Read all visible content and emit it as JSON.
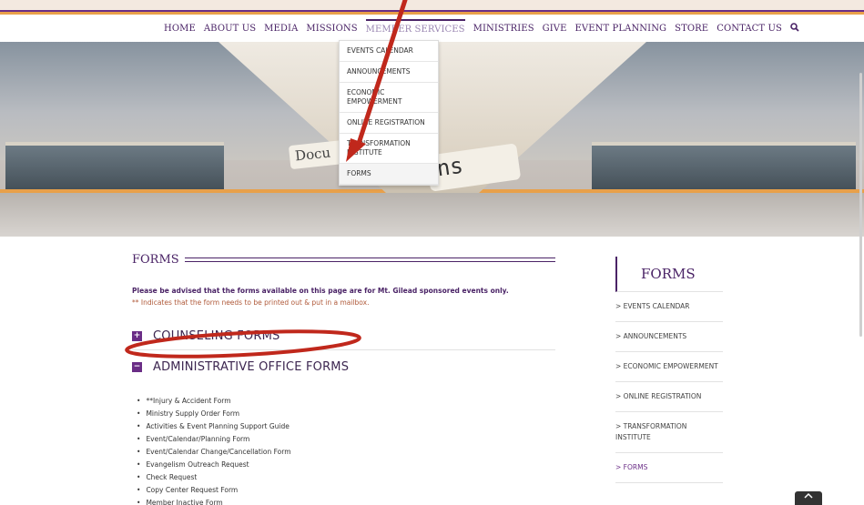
{
  "nav": {
    "items": [
      "HOME",
      "ABOUT US",
      "MEDIA",
      "MISSIONS",
      "MEMBER SERVICES",
      "MINISTRIES",
      "GIVE",
      "EVENT PLANNING",
      "STORE",
      "CONTACT US"
    ],
    "search_icon": "search-icon"
  },
  "dropdown": {
    "items": [
      "EVENTS CALENDAR",
      "ANNOUNCEMENTS",
      "ECONOMIC EMPOWERMENT",
      "ONLINE REGISTRATION",
      "TRANSFORMATION INSTITUTE",
      "FORMS"
    ]
  },
  "hero": {
    "folder_text_left": "Docu",
    "folder_text_right": "ns"
  },
  "content": {
    "title": "FORMS",
    "notice_bold": "Please be advised that the forms available on this page are for Mt. Gilead sponsored events only.",
    "notice": "** Indicates that the form needs to be printed out & put in a mailbox.",
    "sections": [
      {
        "toggle": "+",
        "label": "COUNSELING FORMS"
      },
      {
        "toggle": "−",
        "label": "ADMINISTRATIVE OFFICE FORMS"
      }
    ],
    "forms": [
      "**Injury & Accident Form",
      "Ministry Supply Order Form",
      "Activities & Event Planning Support Guide",
      "Event/Calendar/Planning Form",
      "Event/Calendar Change/Cancellation Form",
      "Evangelism Outreach Request",
      "Check Request",
      "Copy Center Request Form",
      "Member Inactive Form"
    ]
  },
  "sidebar": {
    "title": "FORMS",
    "items": [
      "> EVENTS CALENDAR",
      "> ANNOUNCEMENTS",
      "> ECONOMIC EMPOWERMENT",
      "> ONLINE REGISTRATION",
      "> TRANSFORMATION INSTITUTE",
      "> FORMS"
    ]
  },
  "colors": {
    "brand_purple": "#4a2366",
    "accent_orange": "#e8a04a",
    "annotation_red": "#c0281c"
  },
  "scroll_top_icon": "chevron-up-icon"
}
